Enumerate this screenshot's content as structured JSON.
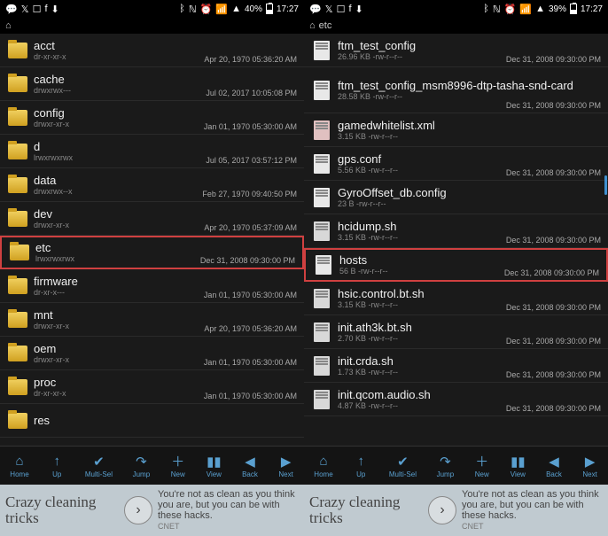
{
  "left": {
    "status": {
      "battery": "40%",
      "time": "17:27"
    },
    "path": "",
    "files": [
      {
        "name": "acct",
        "meta": "dr-xr-xr-x",
        "date": "Apr 20, 1970 05:36:20 AM",
        "type": "folder"
      },
      {
        "name": "cache",
        "meta": "drwxrwx---",
        "date": "Jul 02, 2017 10:05:08 PM",
        "type": "folder"
      },
      {
        "name": "config",
        "meta": "drwxr-xr-x",
        "date": "Jan 01, 1970 05:30:00 AM",
        "type": "folder"
      },
      {
        "name": "d",
        "meta": "lrwxrwxrwx",
        "date": "Jul 05, 2017 03:57:12 PM",
        "type": "folder"
      },
      {
        "name": "data",
        "meta": "drwxrwx--x",
        "date": "Feb 27, 1970 09:40:50 PM",
        "type": "folder"
      },
      {
        "name": "dev",
        "meta": "drwxr-xr-x",
        "date": "Apr 20, 1970 05:37:09 AM",
        "type": "folder"
      },
      {
        "name": "etc",
        "meta": "lrwxrwxrwx",
        "date": "Dec 31, 2008 09:30:00 PM",
        "type": "folder",
        "hl": true
      },
      {
        "name": "firmware",
        "meta": "dr-xr-x---",
        "date": "Jan 01, 1970 05:30:00 AM",
        "type": "folder"
      },
      {
        "name": "mnt",
        "meta": "drwxr-xr-x",
        "date": "Apr 20, 1970 05:36:20 AM",
        "type": "folder"
      },
      {
        "name": "oem",
        "meta": "drwxr-xr-x",
        "date": "Jan 01, 1970 05:30:00 AM",
        "type": "folder"
      },
      {
        "name": "proc",
        "meta": "dr-xr-xr-x",
        "date": "Jan 01, 1970 05:30:00 AM",
        "type": "folder"
      },
      {
        "name": "res",
        "meta": "",
        "date": "",
        "type": "folder"
      }
    ]
  },
  "right": {
    "status": {
      "battery": "39%",
      "time": "17:27"
    },
    "path": "etc",
    "files": [
      {
        "name": "ftm_test_config",
        "meta": "26.96 KB -rw-r--r--",
        "date": "Dec 31, 2008 09:30:00 PM",
        "type": "file"
      },
      {
        "name": "ftm_test_config_msm8996-dtp-tasha-snd-card",
        "meta": "28.58 KB -rw-r--r--",
        "date": "Dec 31, 2008 09:30:00 PM",
        "type": "file",
        "tall": true
      },
      {
        "name": "gamedwhitelist.xml",
        "meta": "3.15 KB -rw-r--r--",
        "date": "",
        "type": "xml"
      },
      {
        "name": "gps.conf",
        "meta": "5.56 KB -rw-r--r--",
        "date": "Dec 31, 2008 09:30:00 PM",
        "type": "file"
      },
      {
        "name": "GyroOffset_db.config",
        "meta": "23 B -rw-r--r--",
        "date": "",
        "type": "file"
      },
      {
        "name": "hcidump.sh",
        "meta": "3.15 KB -rw-r--r--",
        "date": "Dec 31, 2008 09:30:00 PM",
        "type": "sh"
      },
      {
        "name": "hosts",
        "meta": "56 B -rw-r--r--",
        "date": "Dec 31, 2008 09:30:00 PM",
        "type": "file",
        "hl": true
      },
      {
        "name": "hsic.control.bt.sh",
        "meta": "3.15 KB -rw-r--r--",
        "date": "Dec 31, 2008 09:30:00 PM",
        "type": "sh"
      },
      {
        "name": "init.ath3k.bt.sh",
        "meta": "2.70 KB -rw-r--r--",
        "date": "Dec 31, 2008 09:30:00 PM",
        "type": "sh"
      },
      {
        "name": "init.crda.sh",
        "meta": "1.73 KB -rw-r--r--",
        "date": "Dec 31, 2008 09:30:00 PM",
        "type": "sh"
      },
      {
        "name": "init.qcom.audio.sh",
        "meta": "4.87 KB -rw-r--r--",
        "date": "Dec 31, 2008 09:30:00 PM",
        "type": "sh"
      }
    ]
  },
  "toolbar": [
    {
      "label": "Home",
      "icon": "⌂"
    },
    {
      "label": "Up",
      "icon": "↑"
    },
    {
      "label": "Multi-Sel",
      "icon": "✔"
    },
    {
      "label": "Jump",
      "icon": "↷"
    },
    {
      "label": "New",
      "icon": "＋"
    },
    {
      "label": "View",
      "icon": "▮▮"
    },
    {
      "label": "Back",
      "icon": "◀"
    },
    {
      "label": "Next",
      "icon": "▶"
    }
  ],
  "ad": {
    "headline": "Crazy cleaning tricks",
    "body": "You're not as clean as you think you are, but you can be with these hacks.",
    "source": "CNET"
  }
}
